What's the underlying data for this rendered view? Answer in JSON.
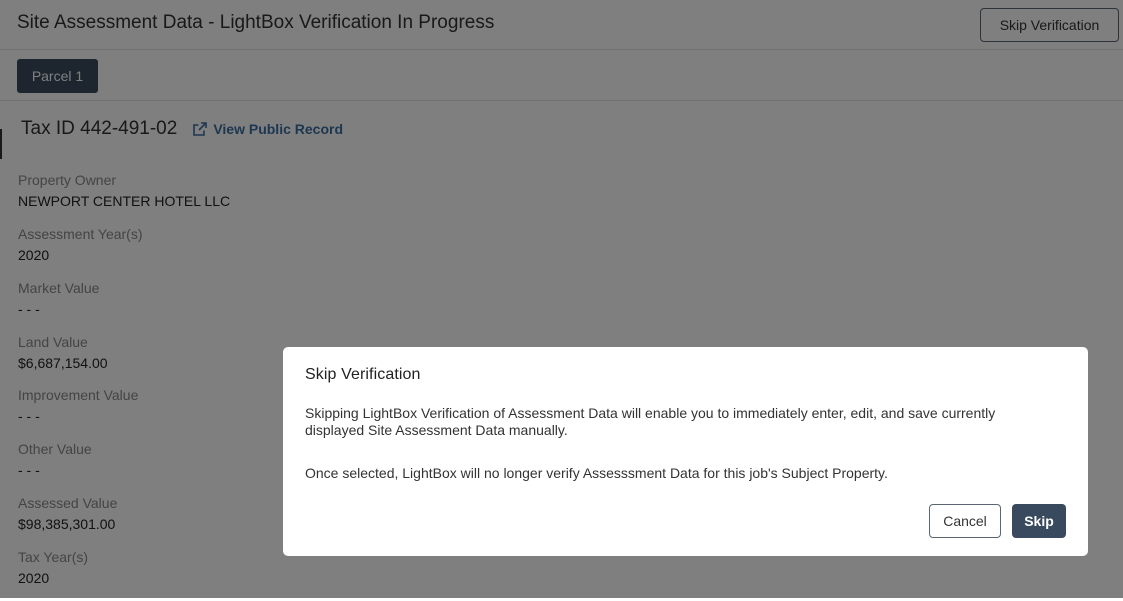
{
  "header": {
    "title": "Site Assessment Data - LightBox Verification In Progress",
    "skip_button": "Skip Verification"
  },
  "tabs": [
    {
      "label": "Parcel 1",
      "active": true
    }
  ],
  "parcel": {
    "tax_id": "Tax ID 442-491-02",
    "public_record_link": "View Public Record",
    "fields": [
      {
        "label": "Property Owner",
        "value": "NEWPORT CENTER HOTEL LLC"
      },
      {
        "label": "Assessment Year(s)",
        "value": "2020"
      },
      {
        "label": "Market Value",
        "value": "- - -"
      },
      {
        "label": "Land Value",
        "value": "$6,687,154.00"
      },
      {
        "label": "Improvement Value",
        "value": "- - -"
      },
      {
        "label": "Other Value",
        "value": "- - -"
      },
      {
        "label": "Assessed Value",
        "value": "$98,385,301.00"
      },
      {
        "label": "Tax Year(s)",
        "value": "2020"
      }
    ]
  },
  "modal": {
    "title": "Skip Verification",
    "paragraph1": "Skipping LightBox Verification of Assessment Data will enable you to immediately enter, edit, and save currently displayed Site Assessment Data manually.",
    "paragraph2": "Once selected, LightBox will no longer verify Assesssment Data for this job's Subject Property.",
    "cancel_label": "Cancel",
    "skip_label": "Skip"
  },
  "colors": {
    "primary_dark": "#3a4a5e",
    "link": "#3d6fa0",
    "overlay": "rgba(0,0,0,0.5)"
  }
}
